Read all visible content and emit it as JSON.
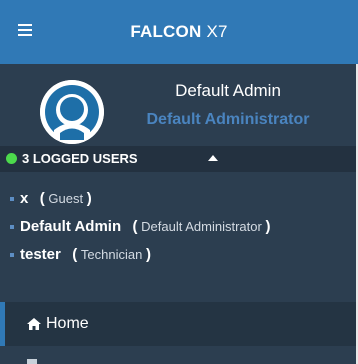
{
  "topbar": {
    "menu_icon": "hamburger-icon",
    "brand": "FALCON",
    "model": "X7"
  },
  "user_panel": {
    "avatar_icon": "user-avatar-icon",
    "name": "Default Admin",
    "role": "Default Administrator"
  },
  "logged_users": {
    "status_icon": "online-dot-icon",
    "label": "3 LOGGED USERS",
    "toggle_icon": "caret-up-icon",
    "users": [
      {
        "name": "x",
        "open_paren": "(",
        "role": "Guest",
        "close_paren": ")"
      },
      {
        "name": "Default Admin",
        "open_paren": "(",
        "role": "Default Administrator",
        "close_paren": ")"
      },
      {
        "name": "tester",
        "open_paren": "(",
        "role": "Technician",
        "close_paren": ")"
      }
    ]
  },
  "nav": {
    "home_icon": "home-icon",
    "home_label": "Home"
  },
  "colors": {
    "topbar": "#3079b6",
    "sidebar": "#2c3e50",
    "role_accent": "#4a84bf",
    "online": "#4cd94c"
  }
}
